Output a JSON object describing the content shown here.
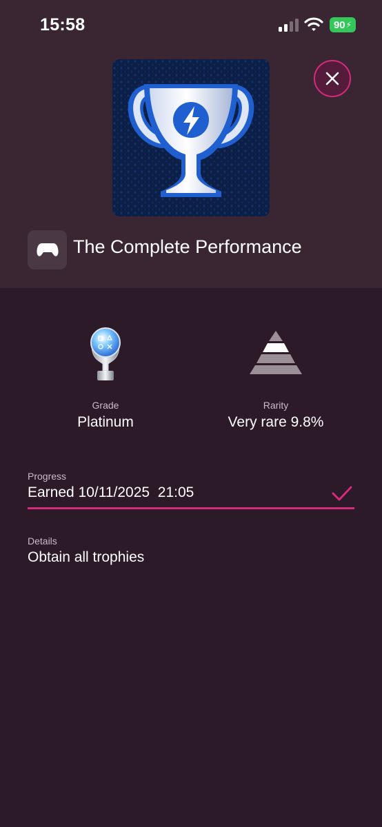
{
  "status_bar": {
    "time": "15:58",
    "battery": "90",
    "icons": [
      "cellular-signal-icon",
      "wifi-icon",
      "battery-charging-icon"
    ]
  },
  "trophy": {
    "title": "The Complete Performance",
    "art_icon": "blue-trophy-cup-icon",
    "game_icon": "gamepad-icon"
  },
  "close_button": {
    "icon": "close-icon"
  },
  "stats": {
    "grade": {
      "label": "Grade",
      "value": "Platinum",
      "icon": "platinum-trophy-icon"
    },
    "rarity": {
      "label": "Rarity",
      "value": "Very rare 9.8%",
      "icon": "rarity-pyramid-icon"
    }
  },
  "progress": {
    "label": "Progress",
    "value": "Earned 10/11/2025  21:05",
    "icon": "checkmark-icon"
  },
  "details": {
    "label": "Details",
    "value": "Obtain all trophies"
  },
  "colors": {
    "background": "#2d1a28",
    "header_background": "#392632",
    "accent": "#d62b7d",
    "muted_text": "#c9bcc4",
    "battery": "#34c759"
  }
}
